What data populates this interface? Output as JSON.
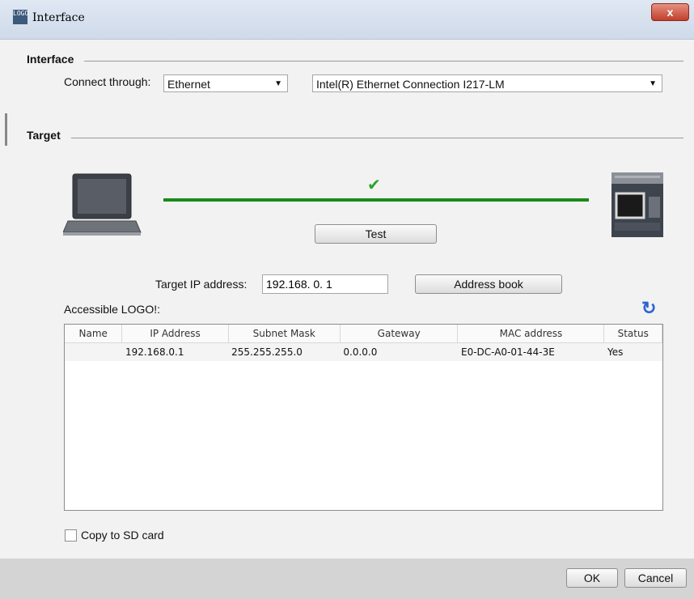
{
  "window": {
    "title": "Interface",
    "icon_text": "LOGO",
    "close_glyph": "x"
  },
  "interface_section": {
    "label": "Interface",
    "connect_label": "Connect through:",
    "connect_value": "Ethernet",
    "adapter_value": "Intel(R) Ethernet Connection I217-LM"
  },
  "target_section": {
    "label": "Target",
    "test_label": "Test",
    "status_glyph": "✔",
    "ip_label": "Target IP address:",
    "ip_value": "192.168. 0. 1",
    "address_book_label": "Address book"
  },
  "accessible": {
    "label": "Accessible LOGO!:",
    "refresh_glyph": "↻",
    "columns": [
      "Name",
      "IP Address",
      "Subnet Mask",
      "Gateway",
      "MAC address",
      "Status"
    ],
    "rows": [
      [
        "",
        "192.168.0.1",
        "255.255.255.0",
        "0.0.0.0",
        "E0-DC-A0-01-44-3E",
        "Yes"
      ]
    ]
  },
  "copy_sd": {
    "label": "Copy to SD card",
    "checked": false
  },
  "footer": {
    "ok_label": "OK",
    "cancel_label": "Cancel"
  },
  "colors": {
    "link_line": "#1a8a1a",
    "check": "#2aa52a",
    "refresh": "#2b63d6"
  }
}
